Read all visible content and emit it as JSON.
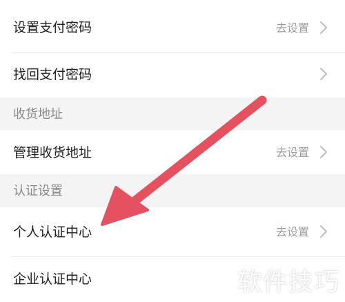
{
  "rows": {
    "set_pay_password": {
      "label": "设置支付密码",
      "value": "去设置"
    },
    "retrieve_pay_password": {
      "label": "找回支付密码"
    },
    "manage_address": {
      "label": "管理收货地址",
      "value": "去设置"
    },
    "personal_auth": {
      "label": "个人认证中心",
      "value": "去设置"
    },
    "enterprise_auth": {
      "label": "企业认证中心"
    }
  },
  "sections": {
    "address": "收货地址",
    "auth": "认证设置"
  },
  "watermark": "软件技巧",
  "colors": {
    "arrow": "#e5515f",
    "background": "#f5f5f5",
    "row": "#ffffff",
    "secondary_text": "#9e9e9e"
  },
  "icons": {
    "chevron": "chevron-right-icon",
    "annotation": "arrow-pointer-icon"
  }
}
